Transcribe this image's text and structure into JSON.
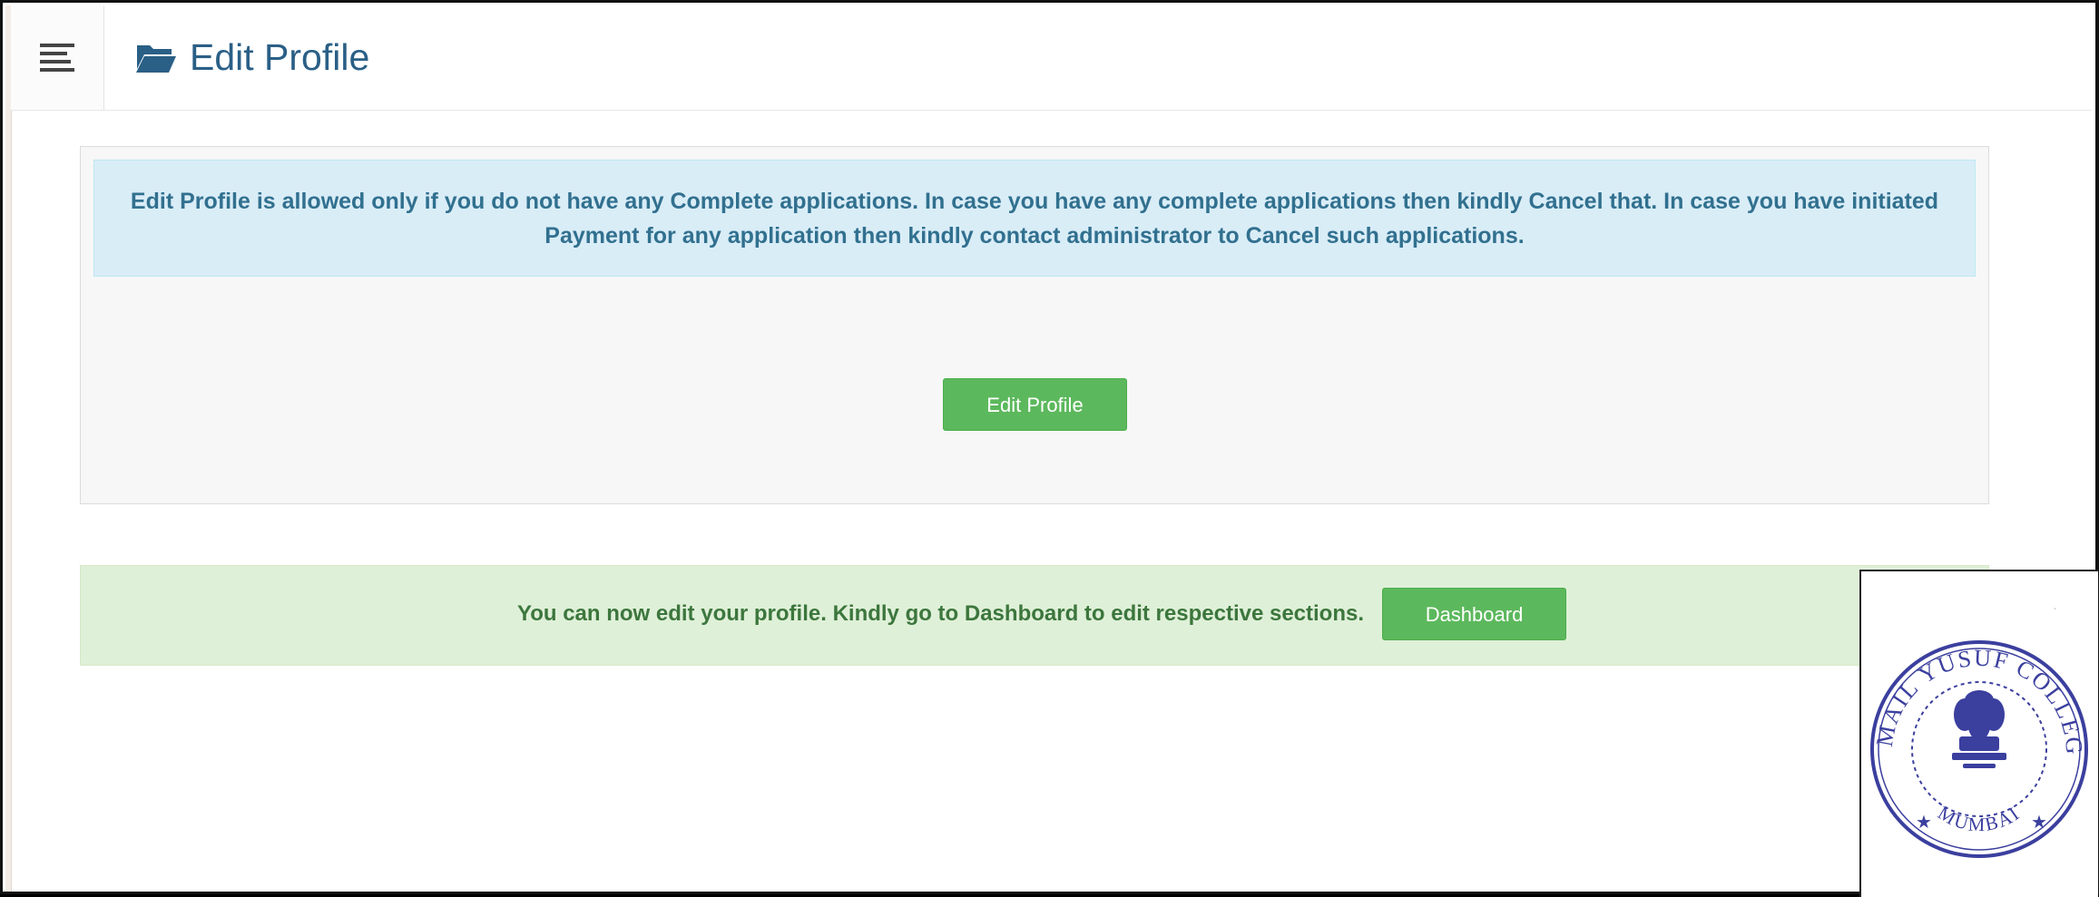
{
  "header": {
    "menu_icon": "hamburger-menu-icon",
    "title_icon": "folder-open-icon",
    "title": "Edit Profile"
  },
  "info_alert": {
    "message": "Edit Profile is allowed only if you do not have any Complete applications. In case you have any complete applications then kindly Cancel that. In case you have initiated Payment for any application then kindly contact administrator to Cancel such applications."
  },
  "edit_button": {
    "label": "Edit Profile"
  },
  "success_alert": {
    "message": "You can now edit your profile. Kindly go to Dashboard to edit respective sections.",
    "button_label": "Dashboard"
  },
  "seal": {
    "top_text": "ISMAIL YUSUF COLLEGE",
    "bottom_text": "MUMBAI"
  },
  "colors": {
    "title": "#2a5f86",
    "info_bg": "#d9edf7",
    "info_text": "#31708f",
    "success_bg": "#dff0d8",
    "success_text": "#3c763d",
    "button": "#5cb85c",
    "seal_ink": "#3b3f9e"
  }
}
